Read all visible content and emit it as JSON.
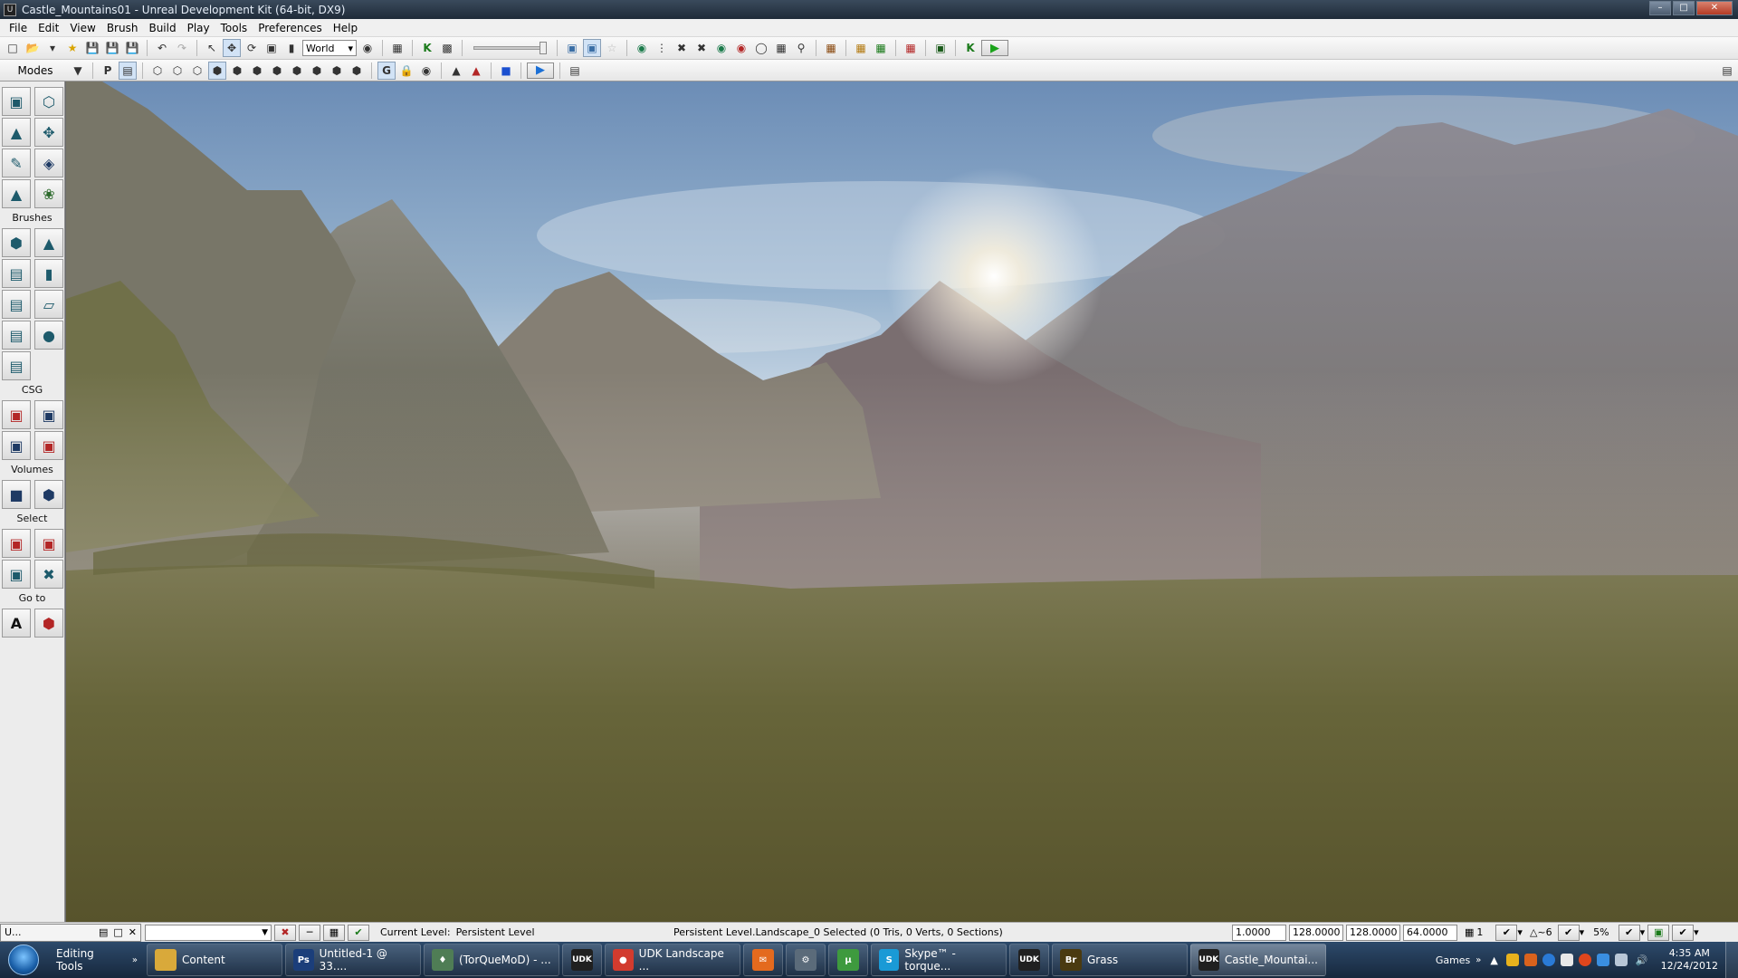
{
  "window": {
    "title": "Castle_Mountains01 - Unreal Development Kit (64-bit, DX9)",
    "minimize": "–",
    "maximize": "□",
    "close": "✕"
  },
  "menu": [
    "File",
    "Edit",
    "View",
    "Brush",
    "Build",
    "Play",
    "Tools",
    "Preferences",
    "Help"
  ],
  "toolbar": {
    "coord_system": "World",
    "modes_label": "Modes"
  },
  "sidebar": {
    "sections": {
      "brushes": "Brushes",
      "csg": "CSG",
      "volumes": "Volumes",
      "select": "Select",
      "goto": "Go to"
    }
  },
  "status": {
    "mini_window_label": "U...",
    "current_level_label": "Current Level:",
    "current_level_value": "Persistent Level",
    "selection_info": "Persistent Level.Landscape_0 Selected (0 Tris, 0 Verts, 0 Sections)",
    "drag_grid": "1.0000",
    "field2": "128.0000",
    "field3": "128.0000",
    "field4": "64.0000",
    "grid_count": "1",
    "rotation_snap": "~6",
    "scale_snap": "5%"
  },
  "taskbar": {
    "toolbar_label": "Editing Tools",
    "tasks": [
      {
        "label": "Content",
        "icon": "folder-icon",
        "color": "#d9a93a"
      },
      {
        "label": "Untitled-1 @ 33....",
        "icon": "photoshop-icon",
        "color": "#1b3e7a",
        "glyph": "Ps"
      },
      {
        "label": "(TorQueMoD) - ...",
        "icon": "chat-icon",
        "color": "#4f7d55",
        "glyph": "♦"
      },
      {
        "label": "",
        "icon": "udk-icon",
        "color": "#202020",
        "glyph": "UDK"
      },
      {
        "label": "UDK Landscape ...",
        "icon": "chrome-icon",
        "color": "#d23b2e",
        "glyph": "●"
      },
      {
        "label": "",
        "icon": "mail-icon",
        "color": "#e46a1e",
        "glyph": "✉"
      },
      {
        "label": "",
        "icon": "network-icon",
        "color": "#5b6b7a",
        "glyph": "⚙"
      },
      {
        "label": "",
        "icon": "utorrent-icon",
        "color": "#3e9a3e",
        "glyph": "µ"
      },
      {
        "label": "Skype™ - torque...",
        "icon": "skype-icon",
        "color": "#1a9ad6",
        "glyph": "S"
      },
      {
        "label": "",
        "icon": "udk-icon",
        "color": "#202020",
        "glyph": "UDK"
      },
      {
        "label": "Grass",
        "icon": "bridge-icon",
        "color": "#4a3a10",
        "glyph": "Br"
      },
      {
        "label": "Castle_Mountai...",
        "icon": "udk-icon",
        "color": "#202020",
        "glyph": "UDK",
        "active": true
      }
    ],
    "games_label": "Games",
    "clock_time": "4:35 AM",
    "clock_date": "12/24/2012"
  },
  "colors": {
    "sky_top": "#6c8db6",
    "grass": "#5f5c32",
    "taskbar": "#1f3550"
  }
}
